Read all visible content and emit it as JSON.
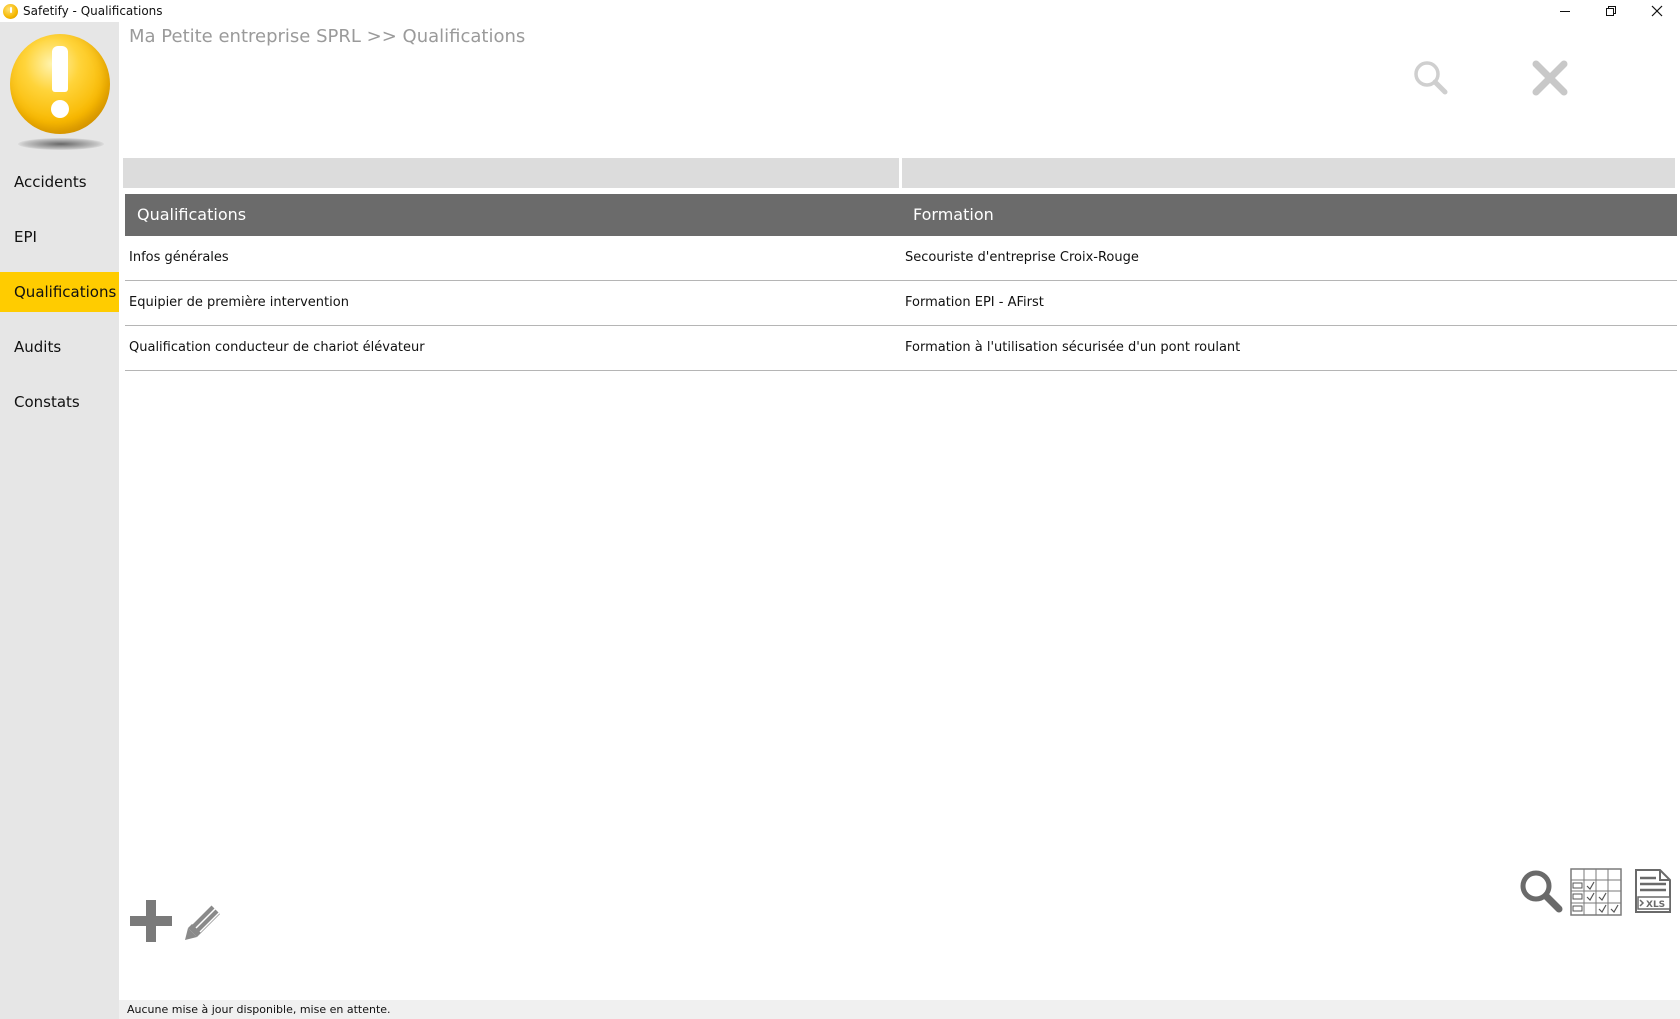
{
  "window": {
    "title": "Safetify - Qualifications"
  },
  "sidebar": {
    "items": [
      {
        "label": "Accidents"
      },
      {
        "label": "EPI"
      },
      {
        "label": "Qualifications",
        "active": true
      },
      {
        "label": "Audits"
      },
      {
        "label": "Constats"
      }
    ]
  },
  "header": {
    "breadcrumb": "Ma Petite entreprise SPRL >> Qualifications"
  },
  "table": {
    "columns": [
      "Qualifications",
      "Formation"
    ],
    "rows": [
      {
        "qualification": "Infos générales",
        "formation": "Secouriste d'entreprise Croix-Rouge"
      },
      {
        "qualification": "Equipier de première intervention",
        "formation": "Formation EPI - AFirst"
      },
      {
        "qualification": "Qualification conducteur de chariot élévateur",
        "formation": "Formation à l'utilisation sécurisée d'un pont roulant"
      }
    ]
  },
  "toolbar": {
    "xls_label": "XLS"
  },
  "status": {
    "text": "Aucune mise à jour disponible, mise en attente."
  },
  "colors": {
    "accent": "#ffcc00",
    "sidebar_bg": "#e6e6e6",
    "table_header_bg": "#6b6b6b",
    "icon_gray": "#7a7a7a"
  },
  "icons": {
    "app": "warning-ball-icon",
    "header_search": "search-icon",
    "header_close": "close-icon",
    "add": "plus-icon",
    "edit": "pencil-icon",
    "tool_search": "search-icon",
    "tool_columns": "column-chooser-icon",
    "tool_xls": "xls-export-icon"
  }
}
